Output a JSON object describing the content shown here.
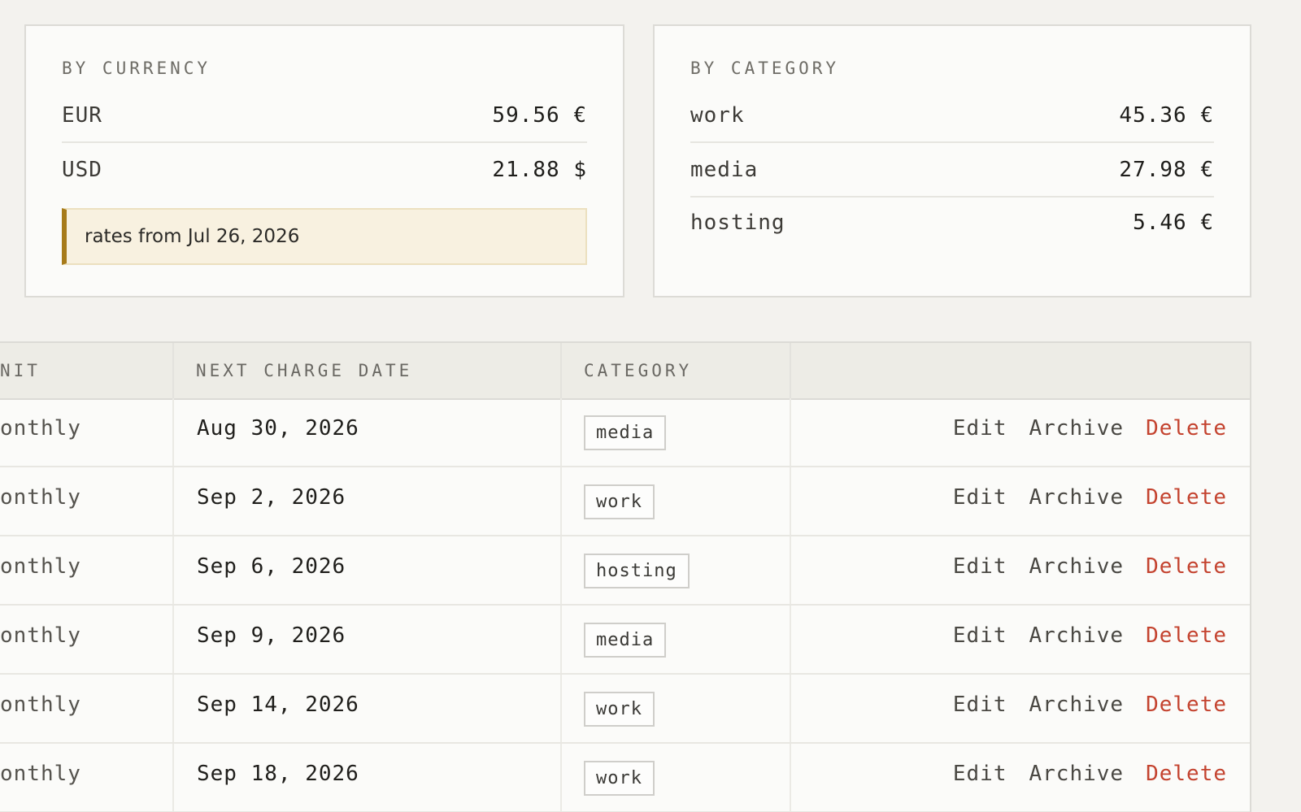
{
  "currency_card": {
    "title": "BY CURRENCY",
    "rows": [
      {
        "label": "EUR",
        "value": "59.56 €"
      },
      {
        "label": "USD",
        "value": "21.88 $"
      }
    ],
    "rates_note": "rates from Jul 26, 2026"
  },
  "category_card": {
    "title": "BY CATEGORY",
    "rows": [
      {
        "label": "work",
        "value": "45.36 €"
      },
      {
        "label": "media",
        "value": "27.98 €"
      },
      {
        "label": "hosting",
        "value": "5.46 €"
      }
    ]
  },
  "table": {
    "headers": {
      "unit": "NIT",
      "next_charge_date": "NEXT CHARGE DATE",
      "category": "CATEGORY"
    },
    "action_labels": {
      "edit": "Edit",
      "archive": "Archive",
      "delete": "Delete"
    },
    "rows": [
      {
        "unit": "onthly",
        "date": "Aug 30, 2026",
        "category": "media"
      },
      {
        "unit": "onthly",
        "date": "Sep 2, 2026",
        "category": "work"
      },
      {
        "unit": "onthly",
        "date": "Sep 6, 2026",
        "category": "hosting"
      },
      {
        "unit": "onthly",
        "date": "Sep 9, 2026",
        "category": "media"
      },
      {
        "unit": "onthly",
        "date": "Sep 14, 2026",
        "category": "work"
      },
      {
        "unit": "onthly",
        "date": "Sep 18, 2026",
        "category": "work"
      }
    ]
  },
  "colors": {
    "background": "#f3f2ee",
    "card": "#fbfbf9",
    "note_background": "#f8f1e0",
    "note_accent": "#a77b1a",
    "delete": "#c4432f"
  }
}
